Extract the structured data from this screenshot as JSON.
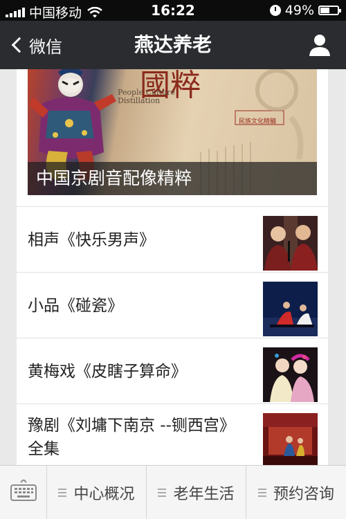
{
  "status_bar": {
    "carrier": "中国移动",
    "time": "16:22",
    "battery": "49%",
    "battery_level": 0.49,
    "icons": [
      "signal-icon",
      "wifi-icon",
      "clock-icon",
      "battery-icon"
    ]
  },
  "nav": {
    "back_label": "微信",
    "title": "燕达养老",
    "icons": [
      "back-chevron-icon",
      "profile-icon"
    ]
  },
  "hero": {
    "caption": "中国京剧音配像精粹",
    "title_chars": "國粹",
    "english_line1": "People Culture",
    "english_line2": "Distillation",
    "tag": "民族文化精髓"
  },
  "articles": [
    {
      "title": "相声《快乐男声》"
    },
    {
      "title": "小品《碰瓷》"
    },
    {
      "title": "黄梅戏《皮瞎子算命》"
    },
    {
      "title": "豫剧《刘墉下南京 --铡西宫》全集"
    }
  ],
  "bottom_menu": {
    "keyboard_icon": "keyboard-icon",
    "items": [
      {
        "label": "中心概况"
      },
      {
        "label": "老年生活"
      },
      {
        "label": "预约咨询"
      }
    ]
  },
  "colors": {
    "nav_bg": "#2a2c30",
    "status_bg": "#0c0c0c",
    "page_bg": "#e9e9ea",
    "caption_bg": "rgba(30,30,30,0.72)"
  }
}
